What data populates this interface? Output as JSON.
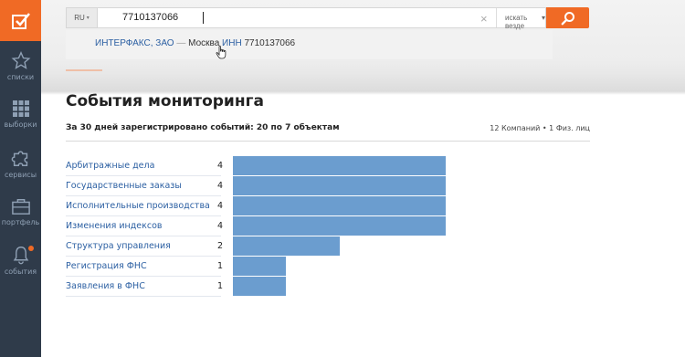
{
  "sidebar": {
    "items": [
      {
        "label": "списки",
        "icon": "star-icon"
      },
      {
        "label": "выборки",
        "icon": "grid-icon"
      },
      {
        "label": "сервисы",
        "icon": "puzzle-icon"
      },
      {
        "label": "портфель",
        "icon": "briefcase-icon"
      },
      {
        "label": "события",
        "icon": "bell-icon",
        "has_notification": true
      }
    ],
    "accent": "#f06a25",
    "background": "#2f3b4a"
  },
  "search": {
    "lang": "RU",
    "value": "7710137066",
    "scope": "искать везде",
    "suggestion": {
      "name": "ИНТЕРФАКС, ЗАО",
      "dash": "—",
      "city": "Москва",
      "inn_label": "ИНН",
      "inn": "7710137066"
    }
  },
  "page": {
    "title": "События мониторинга",
    "summary": "За 30 дней зарегистрировано событий: 20 по 7 объектам",
    "summary_right": "12 Компаний • 1 Физ. лиц"
  },
  "chart_data": {
    "type": "bar",
    "orientation": "horizontal",
    "categories": [
      "Арбитражные дела",
      "Государственные заказы",
      "Исполнительные производства",
      "Изменения индексов",
      "Структура управления",
      "Регистрация ФНС",
      "Заявления в ФНС"
    ],
    "values": [
      4,
      4,
      4,
      4,
      2,
      1,
      1
    ],
    "xlim": [
      0,
      4
    ],
    "bar_color": "#6b9dcf"
  }
}
